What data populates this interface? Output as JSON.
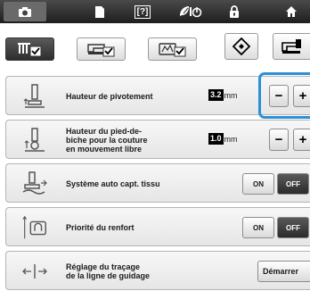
{
  "top_tabs": [
    {
      "icon": "camera-icon",
      "active": true
    },
    {
      "icon": "document-icon",
      "active": false
    },
    {
      "icon": "help-icon",
      "label": "[?]",
      "active": false
    },
    {
      "icon": "eco-icon",
      "active": false
    },
    {
      "icon": "lock-icon",
      "active": false
    },
    {
      "icon": "home-icon",
      "active": false
    }
  ],
  "sub_tabs": [
    {
      "icon": "sewing-settings-icon",
      "selected": true
    },
    {
      "icon": "machine-settings-icon",
      "selected": false
    },
    {
      "icon": "general-settings-icon",
      "selected": false
    }
  ],
  "settings": [
    {
      "label": "Hauteur de pivotement",
      "value": "3.2",
      "unit": "mm",
      "minus": "−",
      "plus": "+",
      "highlighted": true
    },
    {
      "label": "Hauteur du pied-de-\nbiche pour la couture\nen mouvement libre",
      "value": "1.0",
      "unit": "mm",
      "minus": "−",
      "plus": "+"
    },
    {
      "label": "Système auto capt. tissu",
      "on_label": "ON",
      "off_label": "OFF",
      "state": "off"
    },
    {
      "label": "Priorité du renfort",
      "on_label": "ON",
      "off_label": "OFF",
      "state": "off"
    },
    {
      "label": "Réglage du traçage\nde la ligne de guidage",
      "button_label": "Démarrer"
    }
  ],
  "colors": {
    "topbar": "#2a2a2a",
    "highlight": "#2a8fd6",
    "value_bg": "#000000"
  }
}
